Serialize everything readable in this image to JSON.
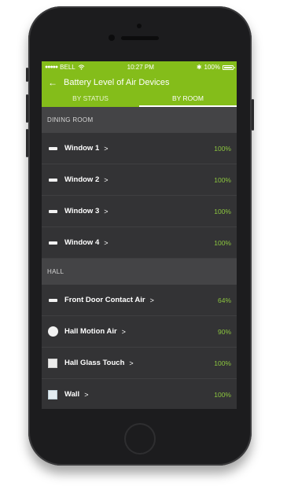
{
  "status_bar": {
    "carrier": "BELL",
    "time": "10:27 PM",
    "battery_percent": "100%",
    "signal_icon": "signal-dots-icon",
    "wifi_icon": "wifi-icon",
    "bluetooth_icon": "bluetooth-icon"
  },
  "header": {
    "back_glyph": "←",
    "title": "Battery Level of Air Devices"
  },
  "tabs": [
    {
      "label": "BY STATUS",
      "active": false
    },
    {
      "label": "BY ROOM",
      "active": true
    }
  ],
  "sections": [
    {
      "title": "DINING ROOM",
      "items": [
        {
          "name": "Window 1",
          "icon": "window-sensor-icon",
          "value": "100%"
        },
        {
          "name": "Window 2",
          "icon": "window-sensor-icon",
          "value": "100%"
        },
        {
          "name": "Window 3",
          "icon": "window-sensor-icon",
          "value": "100%"
        },
        {
          "name": "Window 4",
          "icon": "window-sensor-icon",
          "value": "100%"
        }
      ]
    },
    {
      "title": "HALL",
      "items": [
        {
          "name": "Front Door Contact Air",
          "icon": "door-contact-icon",
          "value": "64%"
        },
        {
          "name": "Hall Motion Air",
          "icon": "motion-sensor-icon",
          "value": "90%"
        },
        {
          "name": "Hall Glass Touch",
          "icon": "glass-touch-icon",
          "value": "100%"
        },
        {
          "name": "Wall",
          "icon": "wall-switch-icon",
          "value": "100%"
        }
      ]
    }
  ],
  "colors": {
    "accent_green": "#84bd1a",
    "value_green": "#8cc63f",
    "list_background": "#333335",
    "section_background": "#444446"
  }
}
